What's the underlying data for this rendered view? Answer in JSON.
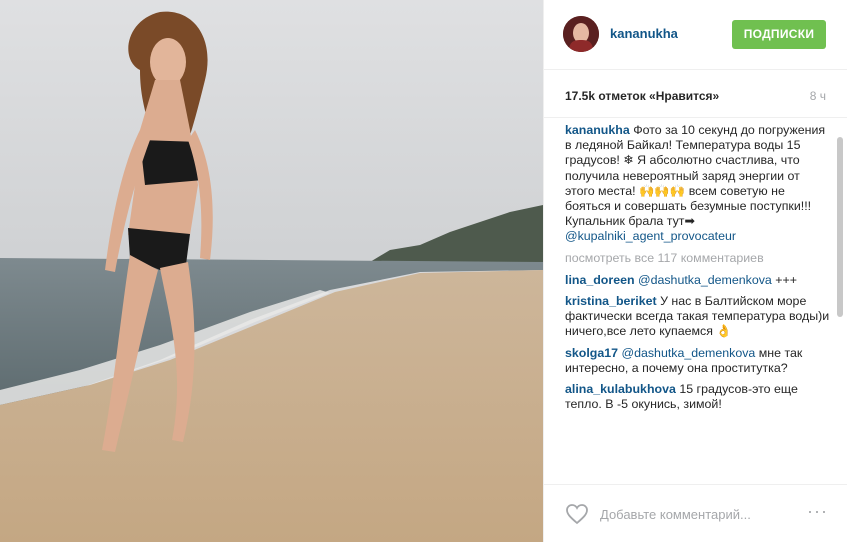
{
  "post": {
    "username": "kananukha",
    "follow_label": "ПОДПИСКИ",
    "likes": "17.5k отметок «Нравится»",
    "time": "8 ч",
    "caption": {
      "user": "kananukha",
      "text": "Фото за 10 секунд до погружения в ледяной Байкал! Температура воды 15 градусов! ❄ Я абсолютно счастлива, что получила невероятный заряд энергии от этого места! ",
      "emoji": "🙌🙌🙌",
      "text2": " всем советую не бояться и совершать безумные поступки!!! Купальник брала тут➡ ",
      "mention": "@kupalniki_agent_provocateur"
    },
    "view_all": "посмотреть все 117 комментариев",
    "comments": [
      {
        "user": "lina_doreen",
        "mention": "@dashutka_demenkova",
        "text": " +++"
      },
      {
        "user": "kristina_beriket",
        "mention": "",
        "text": "У нас в Балтийском море фактически всегда такая температура воды)и ничего,все лето купаемся 👌"
      },
      {
        "user": "skolga17",
        "mention": "@dashutka_demenkova",
        "text": " мне так интересно, а почему она проститутка?"
      },
      {
        "user": "alina_kulabukhova",
        "mention": "",
        "text": "15 градусов-это еще тепло. В -5 окунись, зимой!"
      }
    ],
    "comment_placeholder": "Добавьте комментарий...",
    "more_label": "···",
    "icons": {
      "like": "heart-icon",
      "more": "more-icon"
    }
  },
  "colors": {
    "accent": "#125688",
    "follow": "#70c050",
    "muted": "#a5a7aa"
  }
}
